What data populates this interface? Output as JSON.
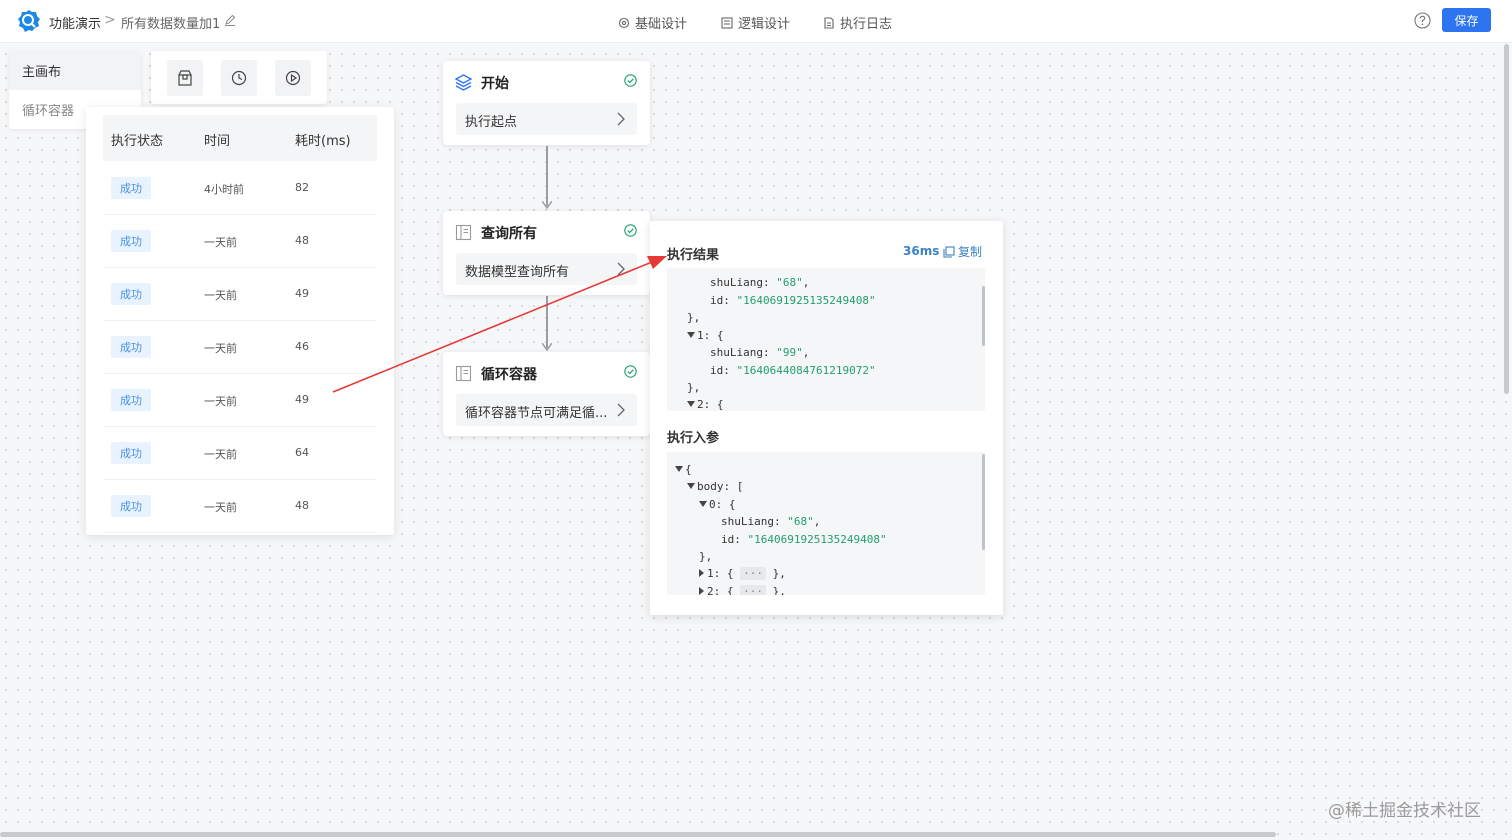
{
  "header": {
    "app_name": "功能演示",
    "breadcrumb_separator": ">",
    "flow_name": "所有数据数量加1",
    "tabs": [
      {
        "label": "基础设计",
        "icon": "gear-icon"
      },
      {
        "label": "逻辑设计",
        "icon": "logic-icon"
      },
      {
        "label": "执行日志",
        "icon": "document-icon"
      }
    ],
    "save_label": "保存"
  },
  "canvas_tabs": {
    "main": "主画布",
    "loop": "循环容器"
  },
  "log_table": {
    "columns": [
      "执行状态",
      "时间",
      "耗时(ms)"
    ],
    "rows": [
      {
        "status": "成功",
        "time": "4小时前",
        "duration": "82"
      },
      {
        "status": "成功",
        "time": "一天前",
        "duration": "48"
      },
      {
        "status": "成功",
        "time": "一天前",
        "duration": "49"
      },
      {
        "status": "成功",
        "time": "一天前",
        "duration": "46"
      },
      {
        "status": "成功",
        "time": "一天前",
        "duration": "49"
      },
      {
        "status": "成功",
        "time": "一天前",
        "duration": "64"
      },
      {
        "status": "成功",
        "time": "一天前",
        "duration": "48"
      }
    ]
  },
  "nodes": [
    {
      "title": "开始",
      "body": "执行起点"
    },
    {
      "title": "查询所有",
      "body": "数据模型查询所有"
    },
    {
      "title": "循环容器",
      "body": "循环容器节点可满足循..."
    }
  ],
  "result_panel": {
    "result_title": "执行结果",
    "duration": "36ms",
    "copy_label": "复制",
    "params_title": "执行入参",
    "result_lines": {
      "l1_key": "shuLiang",
      "l1_val": "\"68\"",
      "l2_key": "id",
      "l2_val": "\"1640691925135249408\"",
      "l3": "},",
      "l4": "1: {",
      "l5_key": "shuLiang",
      "l5_val": "\"99\"",
      "l6_key": "id",
      "l6_val": "\"1640644084761219072\"",
      "l7": "},",
      "l8": "2: {"
    },
    "param_lines": {
      "p1": "{",
      "p2": "body: [",
      "p3": "0: {",
      "p4_key": "shuLiang",
      "p4_val": "\"68\"",
      "p5_key": "id",
      "p5_val": "\"1640691925135249408\"",
      "p6": "},",
      "p7_a": "1: {",
      "p7_ell": "···",
      "p7_b": "},",
      "p8_a": "2: {",
      "p8_ell": "···",
      "p8_b": "},"
    }
  },
  "watermark": "@稀土掘金技术社区",
  "colors": {
    "accent": "#2d74f0",
    "success": "#22a06b",
    "arrow": "#e53935"
  }
}
